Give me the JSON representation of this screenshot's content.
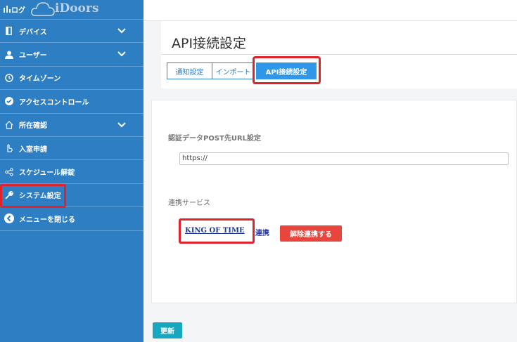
{
  "sidebar": {
    "logo_text": "iDoors",
    "items": [
      {
        "label": "ログ",
        "icon": "bar-chart-icon"
      },
      {
        "label": "デバイス",
        "icon": "door-icon",
        "expandable": true
      },
      {
        "label": "ユーザー",
        "icon": "user-icon",
        "expandable": true
      },
      {
        "label": "タイムゾーン",
        "icon": "clock-icon"
      },
      {
        "label": "アクセスコントロール",
        "icon": "check-circle-icon"
      },
      {
        "label": "所在確認",
        "icon": "home-icon",
        "expandable": true
      },
      {
        "label": "入室申請",
        "icon": "hand-pointer-icon"
      },
      {
        "label": "スケジュール解錠",
        "icon": "share-icon"
      },
      {
        "label": "システム設定",
        "icon": "wrench-icon"
      },
      {
        "label": "メニューを閉じる",
        "icon": "chevron-left-circle-icon"
      }
    ]
  },
  "main": {
    "page_title": "API接続設定",
    "tabs": [
      {
        "label": "通知設定",
        "active": false
      },
      {
        "label": "インポート",
        "active": false
      },
      {
        "label": "API接続設定",
        "active": true
      }
    ],
    "url_section_label": "認証データPOST先URL設定",
    "url_value": "https://",
    "service_section_label": "連携サービス",
    "service_name": "KING OF TIME",
    "service_status": "連携",
    "unlink_button": "解除連携する",
    "update_button": "更新"
  },
  "colors": {
    "sidebar_bg": "#2e7ec4",
    "active_tab": "#2f96e8",
    "highlight": "#e0232b",
    "unlink_button": "#e8453c",
    "update_button": "#17a8c0"
  }
}
